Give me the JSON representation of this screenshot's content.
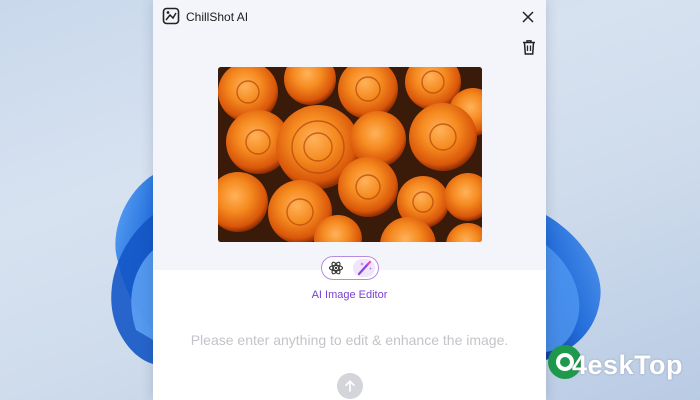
{
  "window": {
    "title": "ChillShot AI",
    "icons": {
      "app": "chillshot-logo-icon",
      "close": "close-icon",
      "trash": "trash-icon"
    }
  },
  "image": {
    "subject": "orange roses photo"
  },
  "mode_toggle": {
    "options": [
      {
        "icon": "atom-icon",
        "active": false
      },
      {
        "icon": "magic-wand-icon",
        "active": true
      }
    ],
    "label": "AI Image Editor"
  },
  "prompt": {
    "placeholder": "Please enter anything to edit & enhance the image.",
    "value": ""
  },
  "send_button": {
    "icon": "arrow-up-icon"
  },
  "watermark": {
    "text": "4eskTop"
  },
  "colors": {
    "accent": "#7a3fd0",
    "toggle_border": "#b58be6",
    "panel_bg": "#f4f5fa",
    "wallpaper_blue": "#1f6fe0"
  }
}
